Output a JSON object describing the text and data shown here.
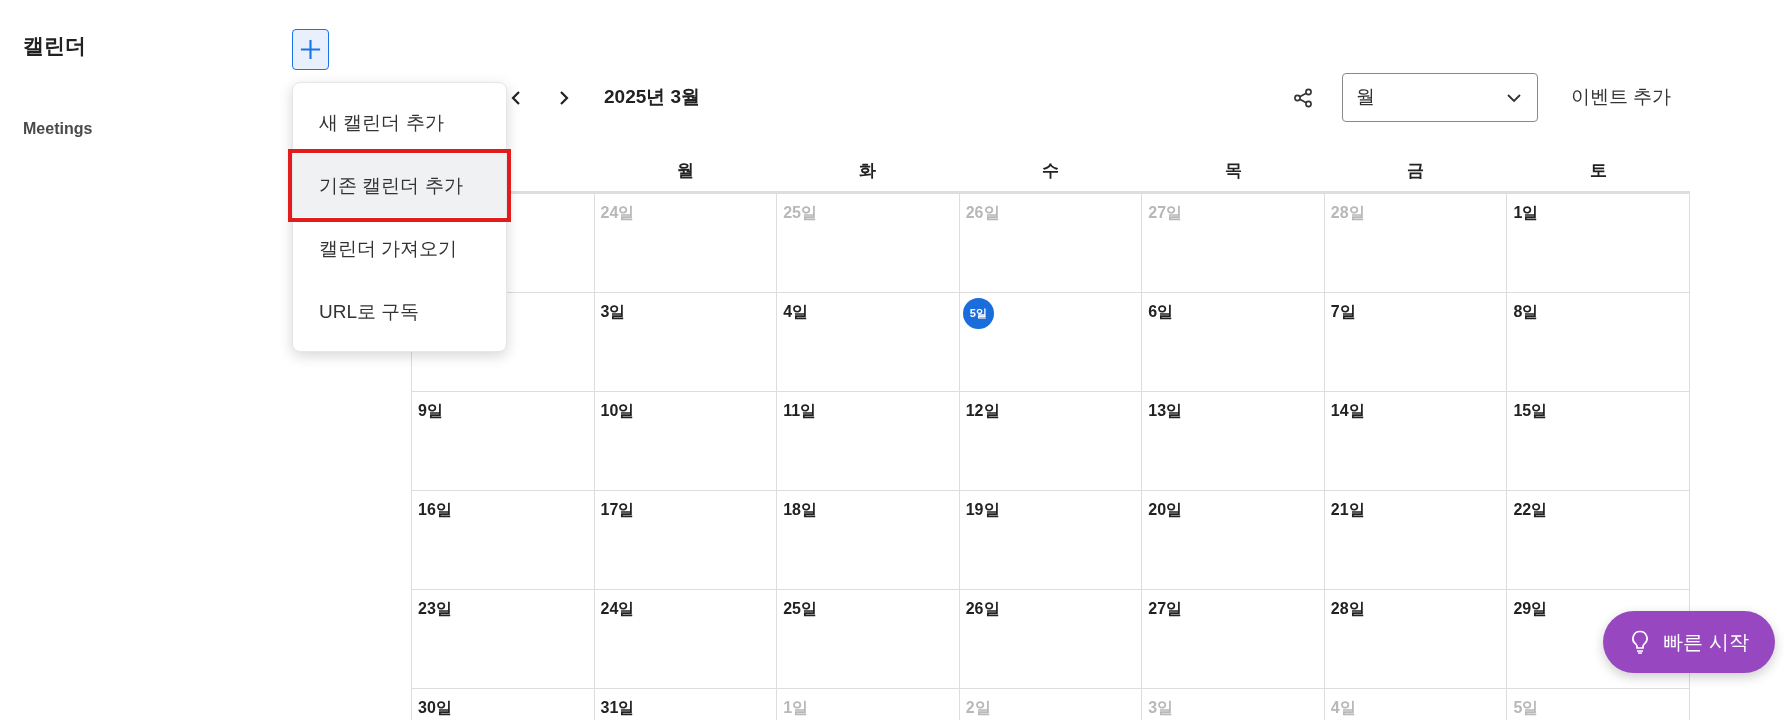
{
  "sidebar": {
    "title": "캘린더",
    "sections": [
      {
        "label": "Meetings"
      }
    ]
  },
  "add_menu": {
    "open": true,
    "items": [
      {
        "label": "새 캘린더 추가",
        "selected": false,
        "outlined": false
      },
      {
        "label": "기존 캘린더 추가",
        "selected": true,
        "outlined": true
      },
      {
        "label": "캘린더 가져오기",
        "selected": false,
        "outlined": false
      },
      {
        "label": "URL로 구독",
        "selected": false,
        "outlined": false
      }
    ]
  },
  "toolbar": {
    "title": "2025년 3월",
    "view": "월",
    "add_event": "이벤트 추가"
  },
  "calendar": {
    "weekdays": [
      "월",
      "화",
      "수",
      "목",
      "금",
      "토"
    ],
    "weeks": [
      [
        {
          "day": "24일",
          "in_month": false,
          "today": false
        },
        {
          "day": "25일",
          "in_month": false,
          "today": false
        },
        {
          "day": "26일",
          "in_month": false,
          "today": false
        },
        {
          "day": "27일",
          "in_month": false,
          "today": false
        },
        {
          "day": "28일",
          "in_month": false,
          "today": false
        },
        {
          "day": "1일",
          "in_month": true,
          "today": false
        }
      ],
      [
        {
          "day": "3일",
          "in_month": true,
          "today": false
        },
        {
          "day": "4일",
          "in_month": true,
          "today": false
        },
        {
          "day": "5일",
          "in_month": true,
          "today": true
        },
        {
          "day": "6일",
          "in_month": true,
          "today": false
        },
        {
          "day": "7일",
          "in_month": true,
          "today": false
        },
        {
          "day": "8일",
          "in_month": true,
          "today": false
        }
      ],
      [
        {
          "day": "9일",
          "in_month": true,
          "today": false
        },
        {
          "day": "10일",
          "in_month": true,
          "today": false
        },
        {
          "day": "11일",
          "in_month": true,
          "today": false
        },
        {
          "day": "12일",
          "in_month": true,
          "today": false
        },
        {
          "day": "13일",
          "in_month": true,
          "today": false
        },
        {
          "day": "14일",
          "in_month": true,
          "today": false
        },
        {
          "day": "15일",
          "in_month": true,
          "today": false
        }
      ],
      [
        {
          "day": "16일",
          "in_month": true,
          "today": false
        },
        {
          "day": "17일",
          "in_month": true,
          "today": false
        },
        {
          "day": "18일",
          "in_month": true,
          "today": false
        },
        {
          "day": "19일",
          "in_month": true,
          "today": false
        },
        {
          "day": "20일",
          "in_month": true,
          "today": false
        },
        {
          "day": "21일",
          "in_month": true,
          "today": false
        },
        {
          "day": "22일",
          "in_month": true,
          "today": false
        }
      ],
      [
        {
          "day": "23일",
          "in_month": true,
          "today": false
        },
        {
          "day": "24일",
          "in_month": true,
          "today": false
        },
        {
          "day": "25일",
          "in_month": true,
          "today": false
        },
        {
          "day": "26일",
          "in_month": true,
          "today": false
        },
        {
          "day": "27일",
          "in_month": true,
          "today": false
        },
        {
          "day": "28일",
          "in_month": true,
          "today": false
        },
        {
          "day": "29일",
          "in_month": true,
          "today": false
        }
      ],
      [
        {
          "day": "30일",
          "in_month": true,
          "today": false
        },
        {
          "day": "31일",
          "in_month": true,
          "today": false
        },
        {
          "day": "1일",
          "in_month": false,
          "today": false
        },
        {
          "day": "2일",
          "in_month": false,
          "today": false
        },
        {
          "day": "3일",
          "in_month": false,
          "today": false
        },
        {
          "day": "4일",
          "in_month": false,
          "today": false
        },
        {
          "day": "5일",
          "in_month": false,
          "today": false
        }
      ]
    ]
  },
  "quick_start": {
    "label": "빠른 시작"
  }
}
